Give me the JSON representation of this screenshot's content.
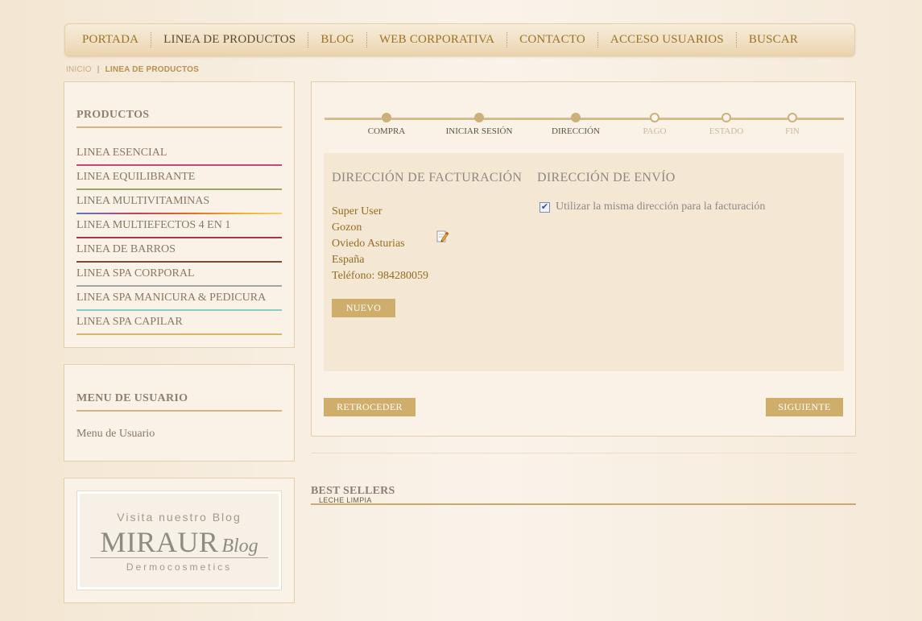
{
  "nav": {
    "items": [
      "PORTADA",
      "LINEA DE PRODUCTOS",
      "BLOG",
      "WEB CORPORATIVA",
      "CONTACTO",
      "ACCESO USUARIOS",
      "BUSCAR"
    ]
  },
  "breadcrumb": {
    "home": "INICIO",
    "separator": "|",
    "current": "LINEA DE PRODUCTOS"
  },
  "sidebar": {
    "products_title": "PRODUCTOS",
    "products": [
      {
        "label": "LINEA ESENCIAL",
        "color": "#c8467e"
      },
      {
        "label": "LINEA EQUILIBRANTE",
        "color": "#9aa66a"
      },
      {
        "label": "LINEA MULTIVITAMINAS",
        "color": "#5a7cc0"
      },
      {
        "label": "LINEA MULTIEFECTOS 4 EN 1",
        "color": "#b0324a"
      },
      {
        "label": "LINEA DE BARROS",
        "color": "#7b4a32"
      },
      {
        "label": "LINEA SPA CORPORAL",
        "color": "#9fa5a2"
      },
      {
        "label": "LINEA SPA MANICURA & PEDICURA",
        "color": "#8ec9c2"
      },
      {
        "label": "LINEA SPA CAPILAR",
        "color": "#e0b45c"
      }
    ],
    "user_menu_title": "MENU DE USUARIO",
    "user_menu_link": "Menu de Usuario",
    "blog": {
      "visit": "Visita nuestro Blog",
      "brand": "MIRAUR",
      "brand_suffix": "Blog",
      "sub": "Dermocosmetics"
    }
  },
  "checkout": {
    "steps": [
      {
        "label": "COMPRA",
        "done": true
      },
      {
        "label": "INICIAR SESIÓN",
        "done": true
      },
      {
        "label": "DIRECCIÓN",
        "done": true
      },
      {
        "label": "PAGO",
        "done": false
      },
      {
        "label": "ESTADO",
        "done": false
      },
      {
        "label": "FIN",
        "done": false
      }
    ],
    "billing_title": "DIRECCIÓN DE FACTURACIÓN",
    "shipping_title": "DIRECCIÓN DE ENVÍO",
    "address": {
      "name": "Super User",
      "city": "Gozon",
      "region": "Oviedo Asturias",
      "country": "España",
      "phone": "Teléfono: 984280059"
    },
    "new_button": "NUEVO",
    "same_address_checked": true,
    "same_address_label": "Utilizar la misma dirección para la facturación",
    "back_button": "RETROCEDER",
    "next_button": "SIGUIENTE"
  },
  "best_sellers": {
    "title": "BEST SELLERS",
    "item": "LECHE LIMPIA"
  },
  "colors": {
    "accent": "#cfad6a",
    "nav_text": "#9b7322",
    "address_text": "#946c1e"
  }
}
